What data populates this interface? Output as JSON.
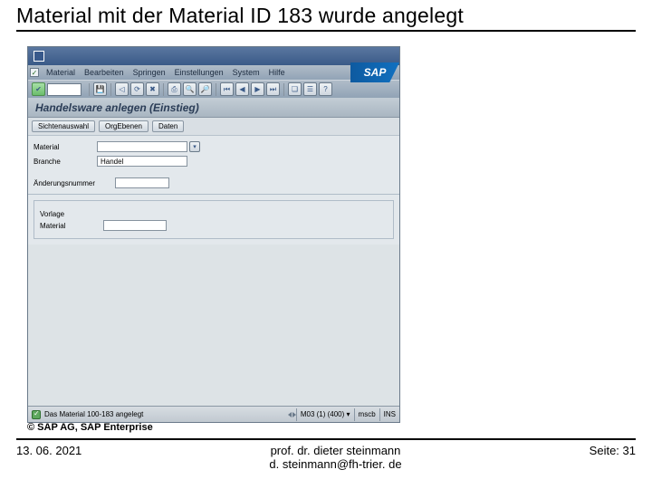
{
  "slide": {
    "title": "Material mit der Material ID 183 wurde angelegt",
    "copyright": "© SAP AG, SAP Enterprise",
    "date": "13. 06. 2021",
    "author_line1": "prof. dr. dieter steinmann",
    "author_line2": "d. steinmann@fh-trier. de",
    "page_label": "Seite: 31"
  },
  "window": {
    "titlebar": "",
    "menu": [
      "Material",
      "Bearbeiten",
      "Springen",
      "Einstellungen",
      "System",
      "Hilfe"
    ],
    "sap_logo": "SAP",
    "subtitle": "Handelsware anlegen (Einstieg)",
    "button_row": [
      "Sichtenauswahl",
      "OrgEbenen",
      "Daten"
    ],
    "form": {
      "material_label": "Material",
      "material_value": "",
      "branche_label": "Branche",
      "branche_value": "Handel",
      "aenderung_label": "Änderungsnummer",
      "aenderung_value": "",
      "vorlage_label": "Vorlage",
      "vorlage_material_label": "Material",
      "vorlage_material_value": ""
    },
    "status": {
      "message": "Das Material 100-183 angelegt",
      "session": "M03 (1) (400) ▾",
      "server": "mscb",
      "mode": "INS"
    }
  }
}
